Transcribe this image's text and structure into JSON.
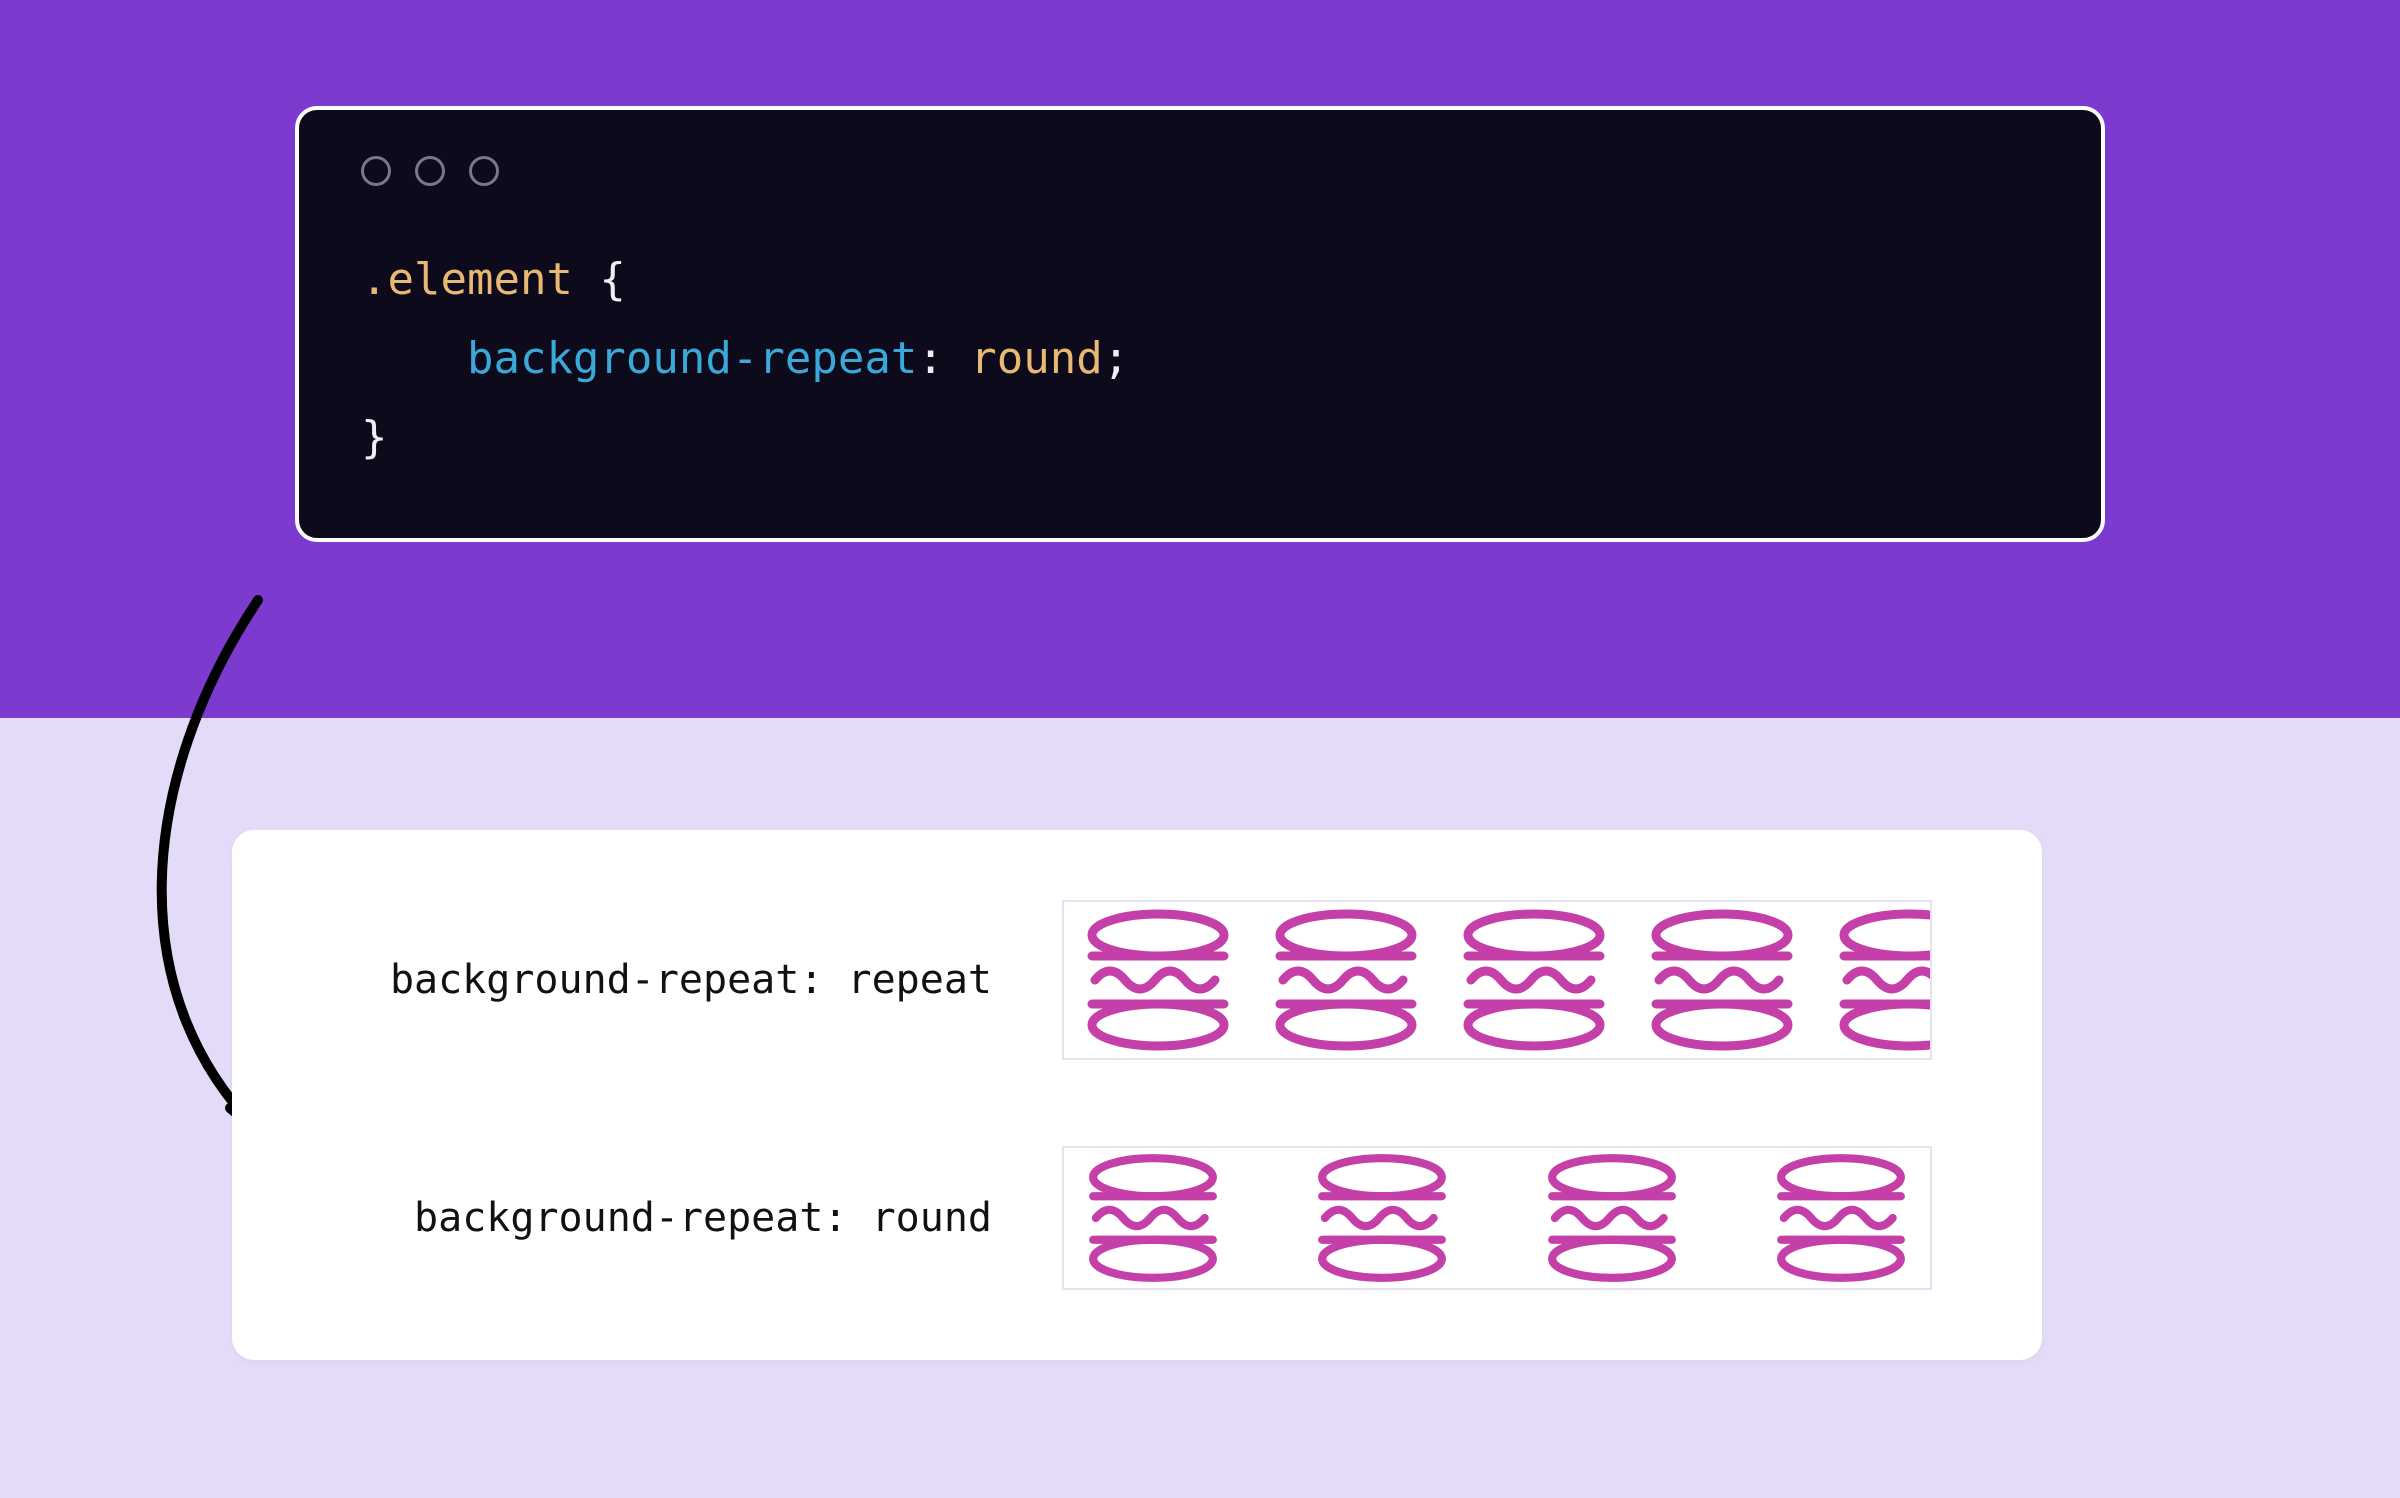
{
  "code": {
    "selector": ".element",
    "brace_open": " {",
    "indent": "    ",
    "property": "background-repeat",
    "colon_space": ": ",
    "value": "round",
    "semicolon": ";",
    "brace_close": "}"
  },
  "examples": {
    "repeat": {
      "label": "background-repeat: repeat"
    },
    "round": {
      "label": "background-repeat: round"
    }
  },
  "colors": {
    "hero_bg": "#7c3acf",
    "page_bg": "#e4dbf9",
    "code_bg": "#0c0a1b",
    "accent_icon": "#c53fa8"
  },
  "icons": {
    "macaron": "macaron-icon",
    "arrow": "arrow-icon",
    "window_dot": "window-dot-icon"
  }
}
